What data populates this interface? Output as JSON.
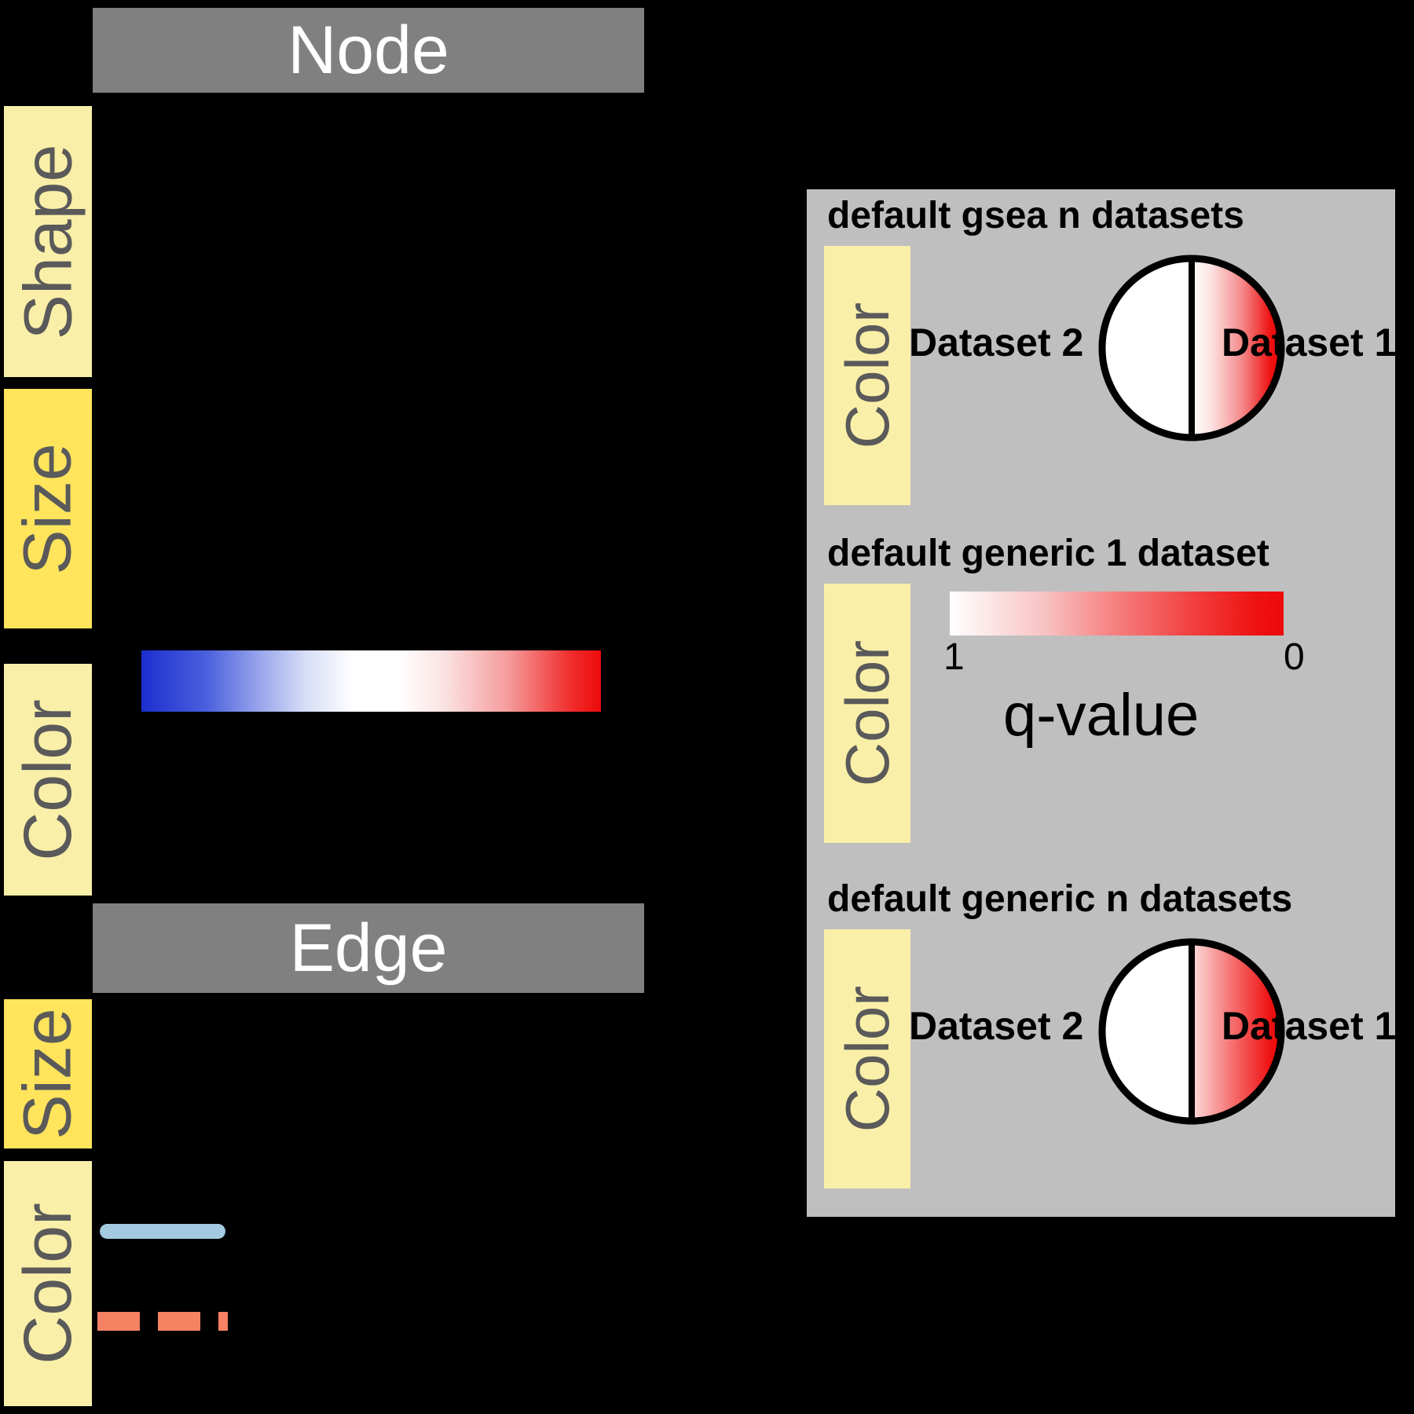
{
  "sections": {
    "node": {
      "title": "Node"
    },
    "edge": {
      "title": "Edge"
    }
  },
  "node_properties": [
    {
      "key": "shape",
      "label": "Shape",
      "tone": "light"
    },
    {
      "key": "size",
      "label": "Size",
      "tone": "strong"
    },
    {
      "key": "color",
      "label": "Color",
      "tone": "light"
    }
  ],
  "edge_properties": [
    {
      "key": "size",
      "label": "Size",
      "tone": "strong"
    },
    {
      "key": "color",
      "label": "Color",
      "tone": "light"
    }
  ],
  "node_color_legend": {
    "type": "diverging-gradient",
    "stops": [
      "#1c2fd0",
      "#ffffff",
      "#ee0a0a"
    ]
  },
  "edge_color_legend": {
    "solid_line_color": "#a3cae0",
    "dashed_line_color": "#f58263"
  },
  "style_panel": {
    "blocks": [
      {
        "id": "default-gsea-n-datasets",
        "title": "default gsea n datasets",
        "property_label": "Color",
        "legend_type": "split-ellipse",
        "left_dataset_label": "Dataset 2",
        "right_dataset_label": "Dataset 1",
        "left_fill": "#ffffff",
        "right_gradient": [
          "#2b3fd4",
          "#ffffff",
          "#ee1111"
        ]
      },
      {
        "id": "default-generic-1-dataset",
        "title": "default generic 1 dataset",
        "property_label": "Color",
        "legend_type": "continuous-bar",
        "caption": "q-value",
        "tick_min": "1",
        "tick_max": "0",
        "gradient": [
          "#ffffff",
          "#ed0909"
        ]
      },
      {
        "id": "default-generic-n-datasets",
        "title": "default generic n datasets",
        "property_label": "Color",
        "legend_type": "split-ellipse",
        "left_dataset_label": "Dataset 2",
        "right_dataset_label": "Dataset 1",
        "left_fill": "#ffffff",
        "right_gradient": [
          "#ffffff",
          "#ee1111"
        ]
      }
    ]
  },
  "colors": {
    "background": "#000000",
    "header_bar": "#808080",
    "header_text": "#ffffff",
    "panel_background": "#bfbfbf",
    "label_yellow_light": "#faefa8",
    "label_yellow_strong": "#ffe45c",
    "label_text": "#5a5a5a"
  }
}
